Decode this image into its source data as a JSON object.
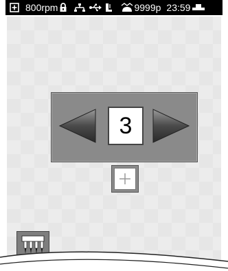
{
  "status_bar": {
    "speed": "800rpm",
    "stitch_count": "9999p",
    "time": "23:59",
    "icons": [
      "expand-icon",
      "lock-icon",
      "network-icon",
      "usb-icon",
      "presser-foot-icon",
      "embroidery-icon",
      "cassette-icon"
    ]
  },
  "selector": {
    "value": "3",
    "left_icon": "left-arrow-icon",
    "right_icon": "right-arrow-icon"
  },
  "add_button": {
    "icon": "plus-icon"
  },
  "hoop_button": {
    "icon": "needles-icon"
  },
  "colors": {
    "status_bar_bg": "#000000",
    "panel_bg": "#8a8a8a",
    "arrow_gradient_light": "#9a9a9a",
    "arrow_gradient_dark": "#2a2a2a"
  }
}
